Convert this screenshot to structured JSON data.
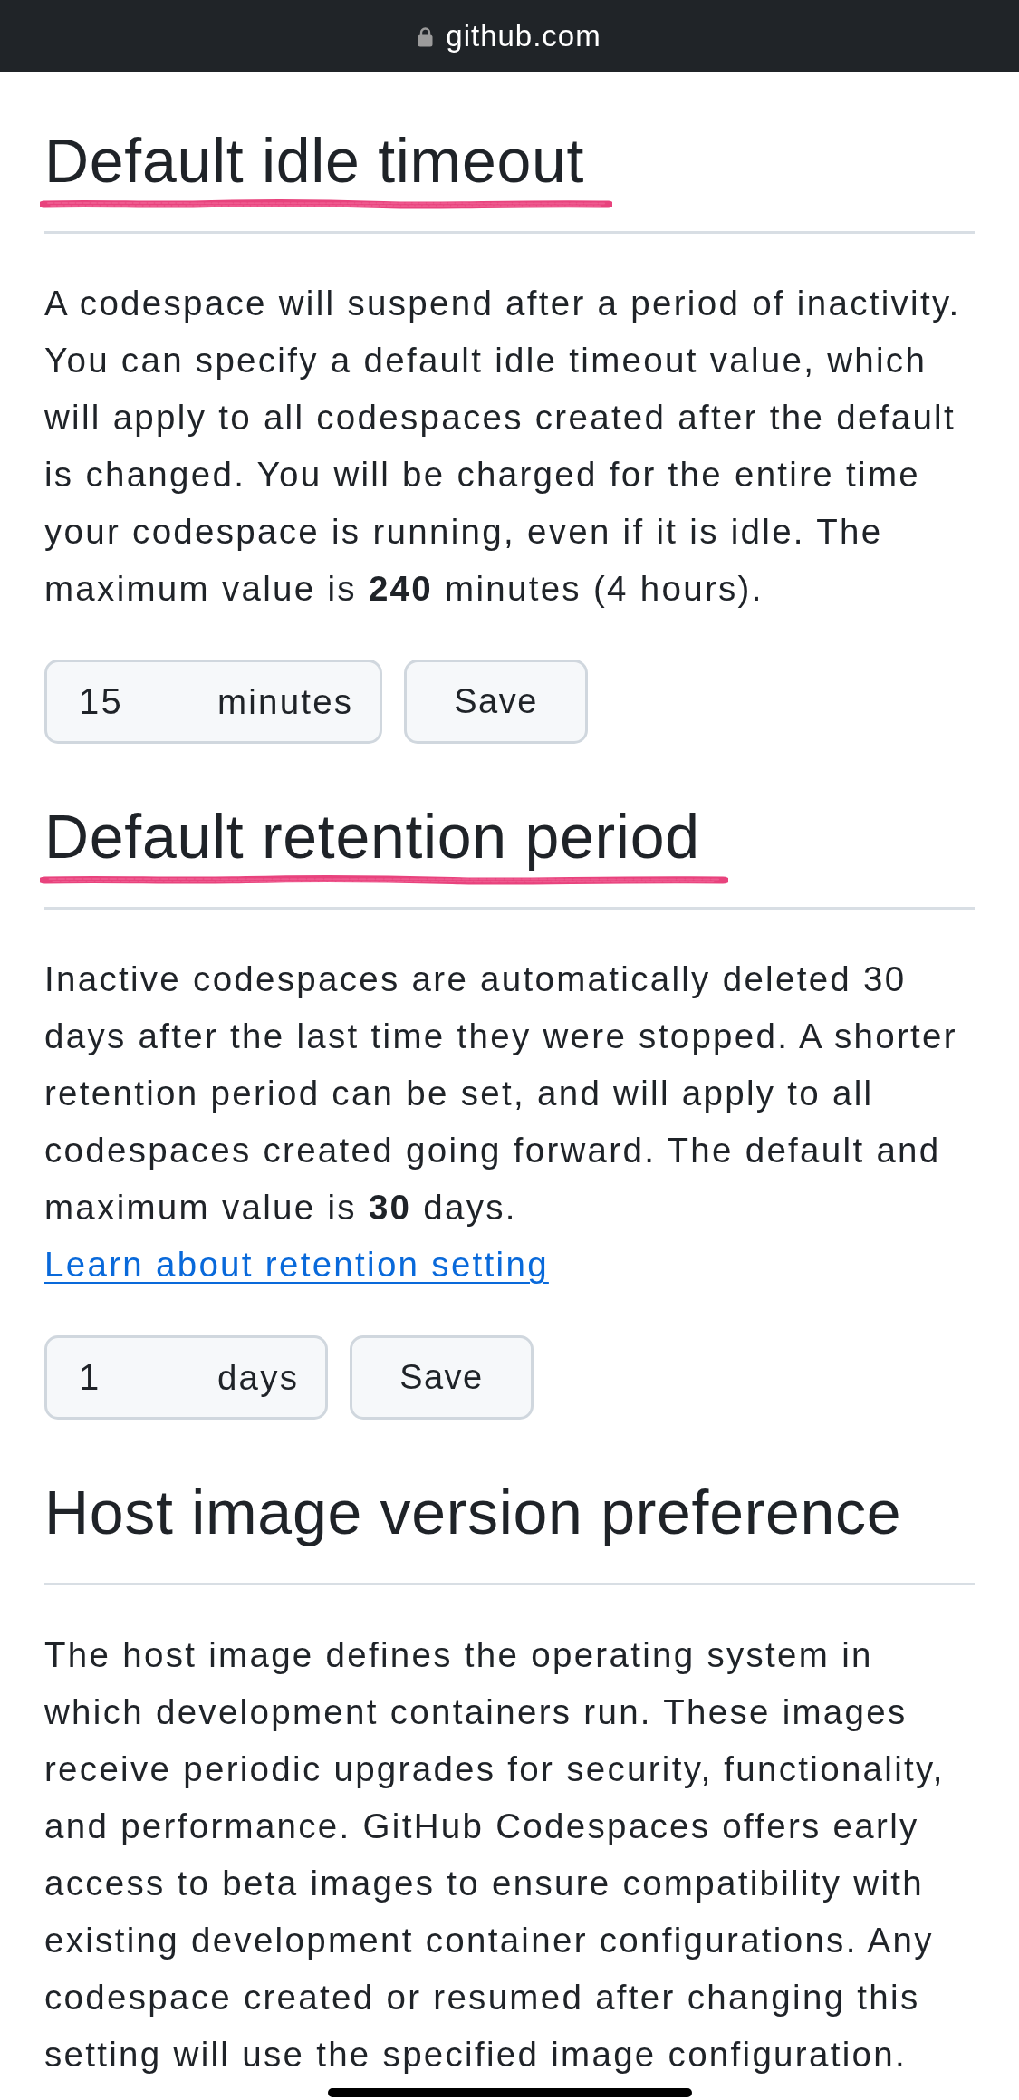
{
  "browser_bar": {
    "domain": "github.com"
  },
  "sections": [
    {
      "heading": "Default idle timeout",
      "annotated": true,
      "body": "A codespace will suspend after a period of inactivity. You can specify a default idle timeout value, which will apply to all codespaces created after the default is changed. You will be charged for the entire time your codespace is running, even if it is idle. The maximum value is **240** minutes (4 hours).",
      "field": {
        "value": "15",
        "unit": "minutes"
      },
      "button": "Save"
    },
    {
      "heading": "Default retention period",
      "annotated": true,
      "body": "Inactive codespaces are automatically deleted 30 days after the last time they were stopped. A shorter retention period can be set, and will apply to all codespaces created going forward. The default and maximum value is **30** days.",
      "link": "Learn about retention setting",
      "field": {
        "value": "1",
        "unit": "days"
      },
      "button": "Save"
    },
    {
      "heading": "Host image version preference",
      "annotated": false,
      "body": "The host image defines the operating system in which development containers run. These images receive periodic upgrades for security, functionality, and performance. GitHub Codespaces offers early access to beta images to ensure compatibility with existing development container configurations. Any codespace created or resumed after changing this setting will use the specified image configuration."
    }
  ]
}
